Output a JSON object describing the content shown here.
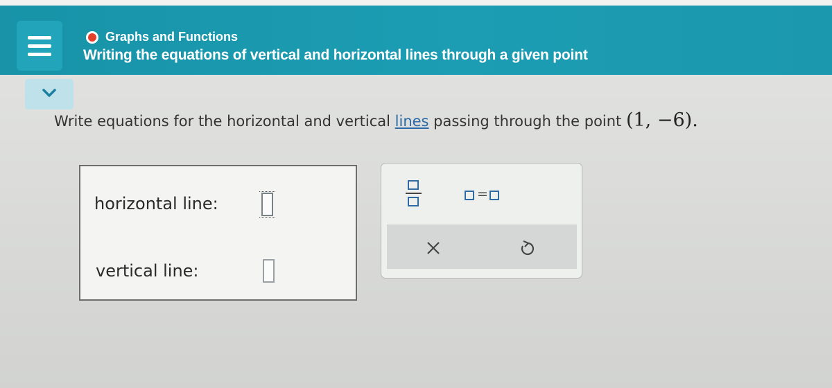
{
  "header": {
    "topic": "Graphs and Functions",
    "title": "Writing the equations of vertical and horizontal lines through a given point",
    "accent_color": "#1b98ad",
    "topic_dot_color": "#e5412a",
    "menu_icon": "hamburger-menu-icon",
    "expand_icon": "chevron-down-icon"
  },
  "question": {
    "prefix": "Write equations for the horizontal and vertical ",
    "link": "lines",
    "suffix": " passing through the point ",
    "point": "(1, −6)",
    "end": "."
  },
  "answers": {
    "horizontal_label": "horizontal line:",
    "vertical_label": "vertical line:",
    "horizontal_value": "",
    "vertical_value": ""
  },
  "toolbar": {
    "fraction_icon": "fraction-template-icon",
    "equation_icon": "equation-template-icon",
    "equals_symbol": "=",
    "clear_icon": "x-icon",
    "undo_icon": "undo-icon"
  }
}
